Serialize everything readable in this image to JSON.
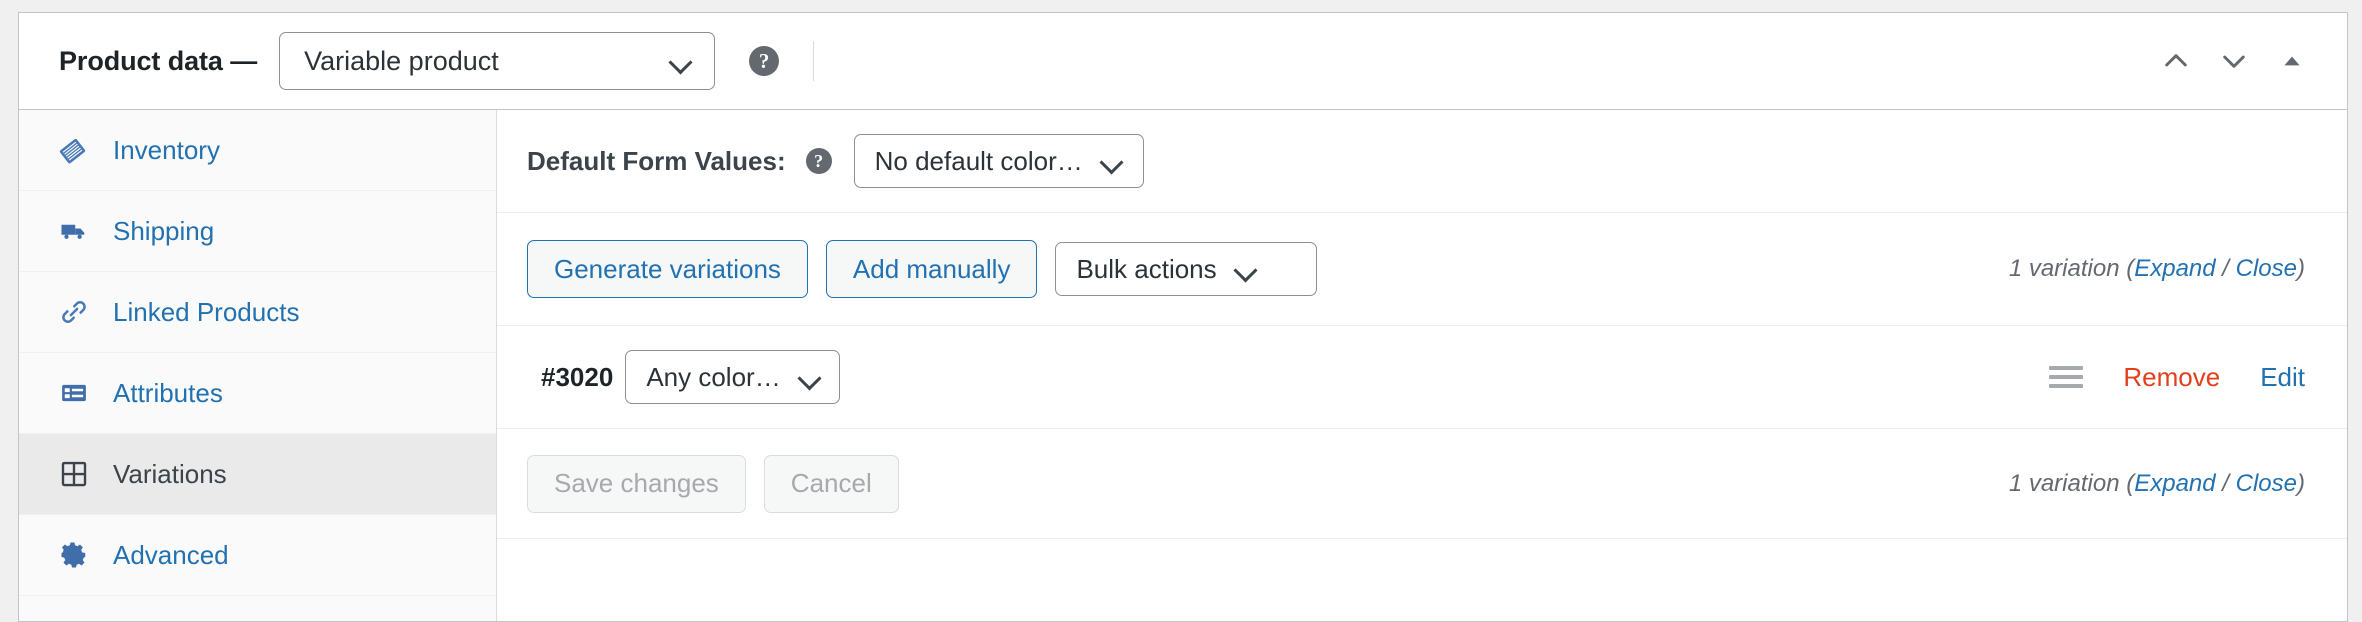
{
  "header": {
    "title": "Product data —",
    "product_type": "Variable product",
    "help_icon": "help-circle-icon",
    "actions": [
      {
        "name": "move-up",
        "icon": "chevron-up-icon"
      },
      {
        "name": "move-down",
        "icon": "chevron-down-icon"
      },
      {
        "name": "toggle-panel",
        "icon": "triangle-up-icon"
      }
    ]
  },
  "sidebar": {
    "items": [
      {
        "label": "Inventory",
        "icon": "archive-tag-icon",
        "active": false
      },
      {
        "label": "Shipping",
        "icon": "truck-icon",
        "active": false
      },
      {
        "label": "Linked Products",
        "icon": "link-icon",
        "active": false
      },
      {
        "label": "Attributes",
        "icon": "list-view-icon",
        "active": false
      },
      {
        "label": "Variations",
        "icon": "grid-icon",
        "active": true
      },
      {
        "label": "Advanced",
        "icon": "gear-icon",
        "active": false
      }
    ]
  },
  "main": {
    "defaults": {
      "label": "Default Form Values:",
      "help_icon": "help-circle-icon",
      "select_value": "No default color…"
    },
    "toolbar": {
      "generate_label": "Generate variations",
      "add_manually_label": "Add manually",
      "bulk_actions_value": "Bulk actions",
      "count_text": "1 variation",
      "expand_label": "Expand",
      "separator": "/",
      "close_label": "Close"
    },
    "variation": {
      "id": "#3020",
      "attribute_value": "Any color…",
      "handle_icon": "drag-handle-icon",
      "remove_label": "Remove",
      "edit_label": "Edit"
    },
    "actions": {
      "save_label": "Save changes",
      "cancel_label": "Cancel",
      "count_text": "1 variation",
      "expand_label": "Expand",
      "separator": "/",
      "close_label": "Close"
    }
  },
  "colors": {
    "link": "#2271b1",
    "danger": "#e2401c",
    "text": "#3c434a",
    "muted": "#646970",
    "panel_border": "#c3c4c7",
    "sidebar_bg": "#fafafa",
    "active_bg": "#eaeaea"
  }
}
